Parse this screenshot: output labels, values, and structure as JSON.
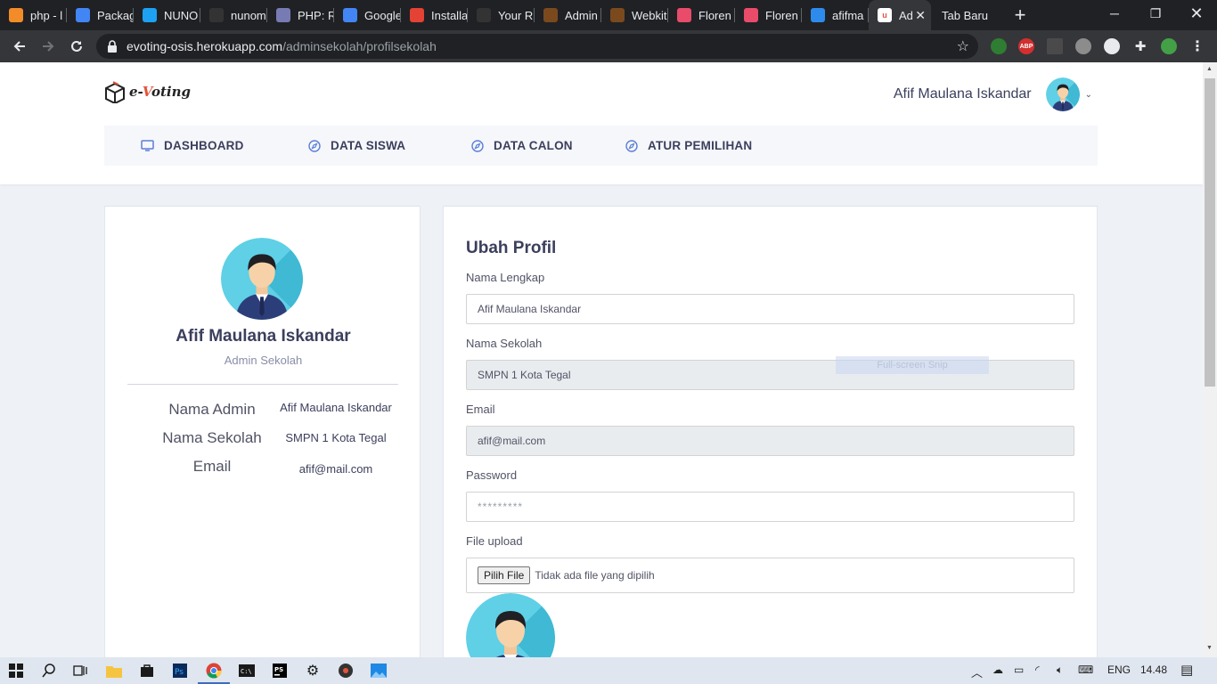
{
  "browser": {
    "tabs": [
      {
        "title": "php - l",
        "color": "#f28c28"
      },
      {
        "title": "Packag",
        "color": "#4285f4"
      },
      {
        "title": "NUNO",
        "color": "#1da1f2"
      },
      {
        "title": "nunom",
        "color": "#333333"
      },
      {
        "title": "PHP: R",
        "color": "#777bb3"
      },
      {
        "title": "Google",
        "color": "#4285f4"
      },
      {
        "title": "Installa",
        "color": "#e34234"
      },
      {
        "title": "Your R",
        "color": "#333333"
      },
      {
        "title": "Admin",
        "color": "#7a4a1e"
      },
      {
        "title": "Webkit",
        "color": "#7a4a1e"
      },
      {
        "title": "Floren",
        "color": "#e94b6a"
      },
      {
        "title": "Floren",
        "color": "#e94b6a"
      },
      {
        "title": "afifma",
        "color": "#2d8ceb"
      }
    ],
    "active_tab": {
      "title": "Ad"
    },
    "plain_tab": {
      "title": "Tab Baru"
    },
    "url_host": "evoting-osis.herokuapp.com",
    "url_path": "/adminsekolah/profilsekolah"
  },
  "header": {
    "logo_prefix": "e-",
    "logo_v": "V",
    "logo_suffix": "oting",
    "username": "Afif Maulana Iskandar"
  },
  "nav": {
    "items": [
      {
        "label": "DASHBOARD",
        "icon": "monitor-icon"
      },
      {
        "label": "DATA SISWA",
        "icon": "compass-icon"
      },
      {
        "label": "DATA CALON",
        "icon": "compass-icon"
      },
      {
        "label": "ATUR PEMILIHAN",
        "icon": "compass-icon"
      }
    ]
  },
  "profile": {
    "name": "Afif Maulana Iskandar",
    "role": "Admin Sekolah",
    "info": [
      {
        "key": "Nama Admin",
        "value": "Afif Maulana Iskandar"
      },
      {
        "key": "Nama Sekolah",
        "value": "SMPN 1 Kota Tegal"
      },
      {
        "key": "Email",
        "value": "afif@mail.com"
      }
    ]
  },
  "form": {
    "title": "Ubah Profil",
    "nama_lengkap_label": "Nama Lengkap",
    "nama_lengkap_value": "Afif Maulana Iskandar",
    "nama_sekolah_label": "Nama Sekolah",
    "nama_sekolah_value": "SMPN 1 Kota Tegal",
    "email_label": "Email",
    "email_value": "afif@mail.com",
    "password_label": "Password",
    "password_placeholder": "*********",
    "file_label": "File upload",
    "file_button": "Pilih File",
    "file_status": "Tidak ada file yang dipilih"
  },
  "overlay": {
    "snip_text": "Full-screen Snip"
  },
  "taskbar": {
    "language": "ENG",
    "time": "14.48"
  }
}
